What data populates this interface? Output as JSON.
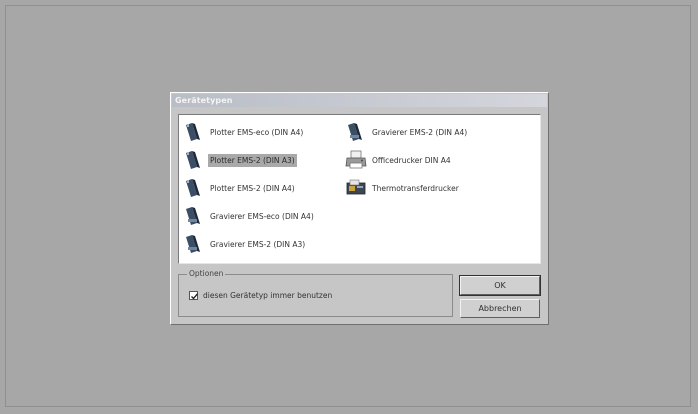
{
  "dialog": {
    "title": "Gerätetypen",
    "device_list": [
      {
        "label": "Plotter EMS-eco (DIN A4)",
        "icon": "plotter-icon",
        "selected": false
      },
      {
        "label": "Plotter EMS-2 (DIN A3)",
        "icon": "plotter-icon",
        "selected": true
      },
      {
        "label": "Plotter EMS-2 (DIN A4)",
        "icon": "plotter-icon",
        "selected": false
      },
      {
        "label": "Gravierer EMS-eco (DIN A4)",
        "icon": "engraver-icon",
        "selected": false
      },
      {
        "label": "Gravierer EMS-2 (DIN A3)",
        "icon": "engraver-icon",
        "selected": false
      },
      {
        "label": "Gravierer EMS-2 (DIN A4)",
        "icon": "engraver-icon",
        "selected": false
      },
      {
        "label": "Officedrucker DIN A4",
        "icon": "printer-icon",
        "selected": false
      },
      {
        "label": "Thermotransferdrucker",
        "icon": "thermal-printer-icon",
        "selected": false
      }
    ],
    "options": {
      "group_title": "Optionen",
      "always_use_label": "diesen Gerätetyp immer benutzen",
      "always_use_checked": true
    },
    "buttons": {
      "ok": "OK",
      "cancel": "Abbrechen"
    }
  },
  "colors": {
    "background": "#a7a7a7",
    "dialog": "#c6c6c6",
    "selection": "#a9a9a9"
  }
}
